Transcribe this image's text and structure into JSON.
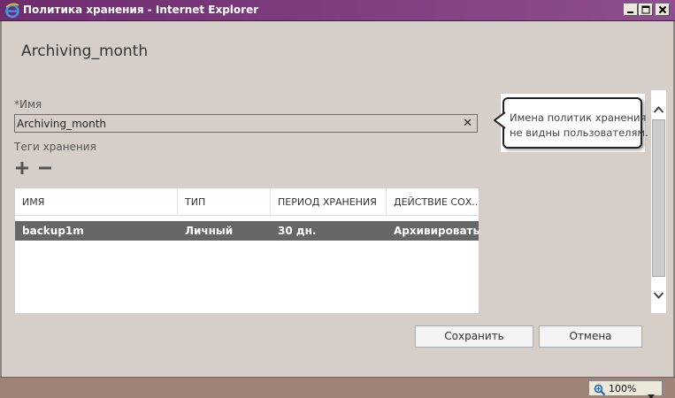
{
  "window": {
    "title": "Политика хранения - Internet Explorer"
  },
  "page": {
    "title": "Archiving_month"
  },
  "name_field": {
    "label": "*Имя",
    "value": "Archiving_month",
    "clear_glyph": "✕"
  },
  "tooltip": {
    "line1": "Имена политик хранения",
    "line2": "не видны пользователям."
  },
  "tags": {
    "label": "Теги хранения",
    "columns": [
      "ИМЯ",
      "ТИП",
      "ПЕРИОД ХРАНЕНИЯ",
      "ДЕЙСТВИЕ СОХ..."
    ],
    "rows": [
      {
        "name": "backup1m",
        "type": "Личный",
        "period": "30 дн.",
        "action": "Архивировать",
        "selected": true
      }
    ]
  },
  "buttons": {
    "save": "Сохранить",
    "cancel": "Отмена"
  },
  "statusbar": {
    "zoom": "100%"
  },
  "icons": {
    "app": "ie-icon",
    "add": "plus-icon",
    "remove": "minus-icon",
    "zoom": "zoom-icon"
  },
  "colors": {
    "titlebar": "#7b3a7c",
    "background": "#d6cfc9",
    "selected_row": "#666666",
    "statusbar": "#9e8478"
  }
}
